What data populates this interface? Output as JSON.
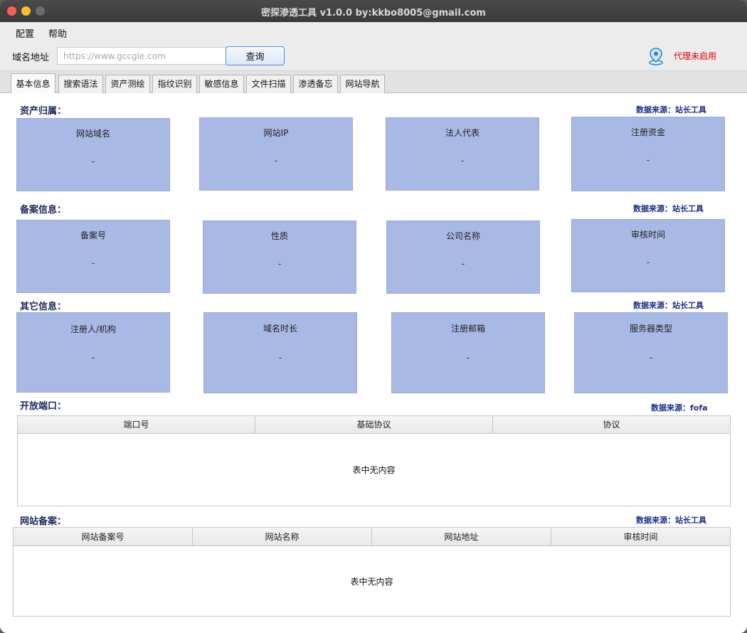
{
  "window": {
    "title": "密探渗透工具  v1.0.0 by:kkbo8005@gmail.com"
  },
  "menu": {
    "items": [
      "配置",
      "帮助"
    ]
  },
  "search": {
    "label": "域名地址",
    "placeholder": "https://www.gccgle.com",
    "value": "",
    "button": "查询"
  },
  "proxy": {
    "status": "代理未启用",
    "icon": "map-pin-icon",
    "color": "#e00000"
  },
  "tabs": [
    "基本信息",
    "搜索语法",
    "资产测绘",
    "指纹识别",
    "敏感信息",
    "文件扫描",
    "渗透备忘",
    "网站导航"
  ],
  "active_tab": "基本信息",
  "asset": {
    "title": "资产归属：",
    "source": "数据来源：站长工具",
    "cards": [
      {
        "label": "网站域名",
        "value": "-"
      },
      {
        "label": "网站IP",
        "value": "-"
      },
      {
        "label": "法人代表",
        "value": "-"
      },
      {
        "label": "注册资金",
        "value": "-"
      }
    ]
  },
  "icp": {
    "title": "备案信息：",
    "source": "数据来源：站长工具",
    "cards": [
      {
        "label": "备案号",
        "value": "-"
      },
      {
        "label": "性质",
        "value": "-"
      },
      {
        "label": "公司名称",
        "value": "-"
      },
      {
        "label": "审核时间",
        "value": "-"
      }
    ]
  },
  "other": {
    "title": "其它信息：",
    "source": "数据来源：站长工具",
    "cards": [
      {
        "label": "注册人/机构",
        "value": "-"
      },
      {
        "label": "域名时长",
        "value": "-"
      },
      {
        "label": "注册邮箱",
        "value": "-"
      },
      {
        "label": "服务器类型",
        "value": "-"
      }
    ]
  },
  "ports": {
    "title": "开放端口：",
    "source": "数据来源：fofa",
    "columns": [
      "端口号",
      "基础协议",
      "协议"
    ],
    "empty": "表中无内容"
  },
  "sites": {
    "title": "网站备案：",
    "source": "数据来源：站长工具",
    "columns": [
      "网站备案号",
      "网站名称",
      "网站地址",
      "审核时间"
    ],
    "empty": "表中无内容"
  },
  "colors": {
    "card": "#a9b9e5",
    "section_title": "#1a2a5c",
    "source": "#1c2e8c"
  }
}
